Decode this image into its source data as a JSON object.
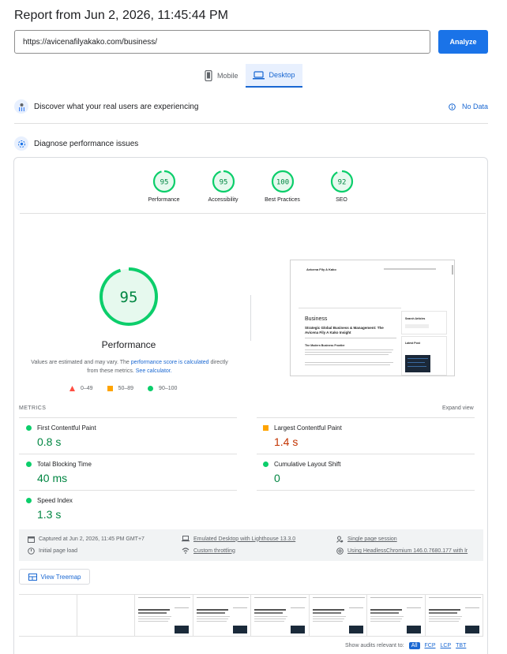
{
  "report": {
    "title": "Report from Jun 2, 2026, 11:45:44 PM",
    "url_value": "https://avicenafilyakako.com/business/",
    "analyze_label": "Analyze"
  },
  "device_tabs": [
    {
      "label": "Mobile",
      "icon": "phone-icon",
      "active": false
    },
    {
      "label": "Desktop",
      "icon": "laptop-icon",
      "active": true
    }
  ],
  "sections": {
    "field": {
      "label": "Discover what your real users are experiencing",
      "status": "No Data"
    },
    "lab": {
      "label": "Diagnose performance issues"
    }
  },
  "scores": [
    {
      "label": "Performance",
      "score": "95",
      "fraction": 0.95
    },
    {
      "label": "Accessibility",
      "score": "95",
      "fraction": 0.95
    },
    {
      "label": "Best Practices",
      "score": "100",
      "fraction": 1.0
    },
    {
      "label": "SEO",
      "score": "92",
      "fraction": 0.92
    }
  ],
  "main_score": {
    "score": "95",
    "fraction": 0.95,
    "label": "Performance",
    "note_1": "Values are estimated and may vary. The ",
    "note_link_1": "performance score is calculated",
    "note_2": " directly from these metrics. ",
    "note_link_2": "See calculator."
  },
  "legend": [
    {
      "label": "0–49",
      "color": "#ff4e42",
      "shape": "triangle"
    },
    {
      "label": "50–89",
      "color": "#ffa400",
      "shape": "square"
    },
    {
      "label": "90–100",
      "color": "#0cce6b",
      "shape": "circle"
    }
  ],
  "preview": {
    "site_name": "Avicena Fily A Kako",
    "section": "Business",
    "headline": "Strategic Global Business & Management: The Avicena Fily A Kako Insight",
    "subhead": "The Modern Business Frontier",
    "sidebar_1": "Search Articles",
    "sidebar_2": "Latest Post"
  },
  "metrics": {
    "header": "METRICS",
    "expand": "Expand view",
    "items": [
      {
        "name": "First Contentful Paint",
        "value": "0.8 s",
        "rating": "good"
      },
      {
        "name": "Largest Contentful Paint",
        "value": "1.4 s",
        "rating": "average"
      },
      {
        "name": "Total Blocking Time",
        "value": "40 ms",
        "rating": "good"
      },
      {
        "name": "Cumulative Layout Shift",
        "value": "0",
        "rating": "good"
      },
      {
        "name": "Speed Index",
        "value": "1.3 s",
        "rating": "good"
      }
    ]
  },
  "environment": {
    "captured": "Captured at Jun 2, 2026, 11:45 PM GMT+7",
    "load": "Initial page load",
    "emulated": "Emulated Desktop with Lighthouse 13.3.0",
    "throttling": "Custom throttling",
    "session": "Single page session",
    "browser": "Using HeadlessChromium 146.0.7680.177 with lr"
  },
  "treemap_label": "View Treemap",
  "audits": {
    "label": "Show audits relevant to:",
    "chips": [
      "All",
      "FCP",
      "LCP",
      "TBT"
    ]
  },
  "colors": {
    "accent": "#1a73e8",
    "pass": "#0cce6b",
    "pass_text": "#018642",
    "average": "#ffa400",
    "fail": "#ff4e42"
  }
}
